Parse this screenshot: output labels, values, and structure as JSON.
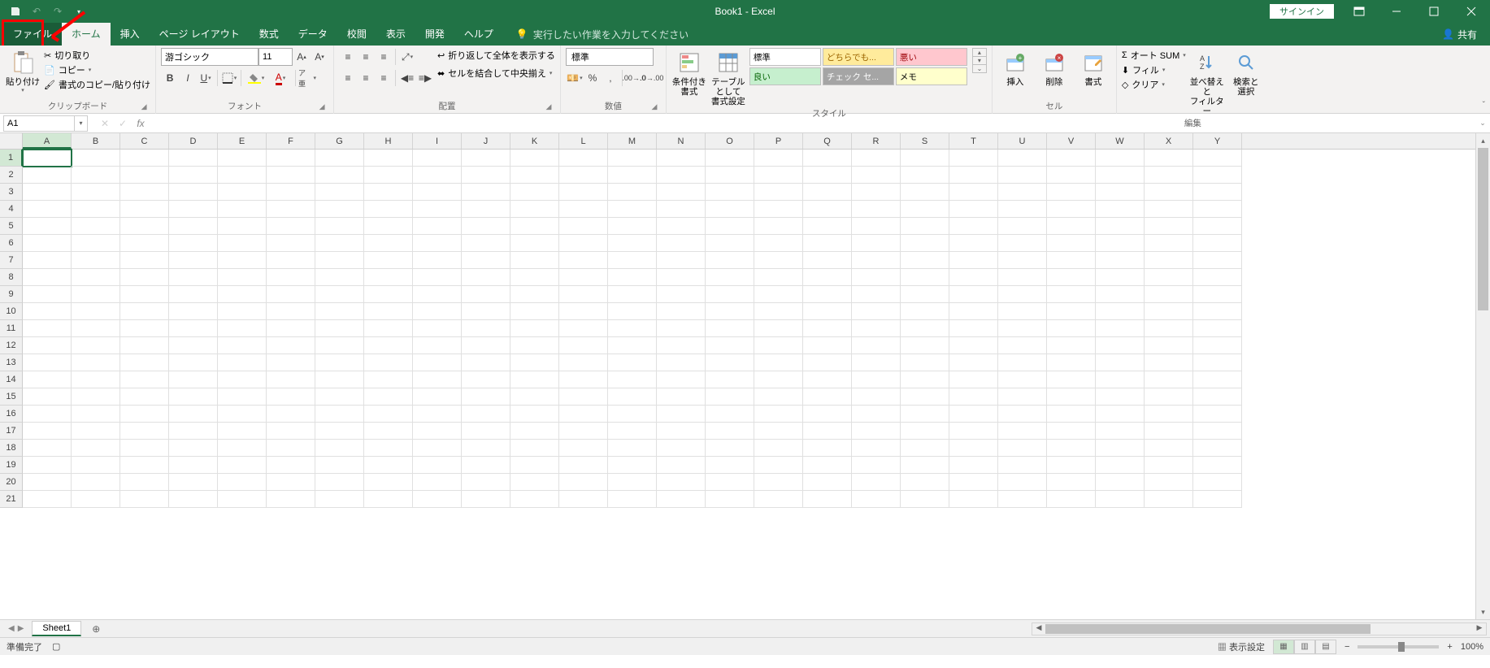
{
  "title": "Book1 - Excel",
  "signin": "サインイン",
  "tabs": {
    "file": "ファイル",
    "home": "ホーム",
    "insert": "挿入",
    "page_layout": "ページ レイアウト",
    "formulas": "数式",
    "data": "データ",
    "review": "校閲",
    "view": "表示",
    "developer": "開発",
    "help": "ヘルプ",
    "tell_me": "実行したい作業を入力してください",
    "share": "共有"
  },
  "ribbon": {
    "clipboard": {
      "paste": "貼り付け",
      "cut": "切り取り",
      "copy": "コピー",
      "format_painter": "書式のコピー/貼り付け",
      "label": "クリップボード"
    },
    "font": {
      "name": "游ゴシック",
      "size": "11",
      "label": "フォント"
    },
    "alignment": {
      "wrap": "折り返して全体を表示する",
      "merge": "セルを結合して中央揃え",
      "label": "配置"
    },
    "number": {
      "format": "標準",
      "label": "数値"
    },
    "styles": {
      "cond_fmt": "条件付き\n書式",
      "table": "テーブルとして\n書式設定",
      "s1": "標準",
      "s2": "どちらでも...",
      "s3": "悪い",
      "s4": "良い",
      "s5": "チェック セ...",
      "s6": "メモ",
      "label": "スタイル"
    },
    "cells": {
      "insert": "挿入",
      "delete": "削除",
      "format": "書式",
      "label": "セル"
    },
    "editing": {
      "autosum": "オート SUM",
      "fill": "フィル",
      "clear": "クリア",
      "sort": "並べ替えと\nフィルター",
      "find": "検索と\n選択",
      "label": "編集"
    }
  },
  "name_box": "A1",
  "columns": [
    "A",
    "B",
    "C",
    "D",
    "E",
    "F",
    "G",
    "H",
    "I",
    "J",
    "K",
    "L",
    "M",
    "N",
    "O",
    "P",
    "Q",
    "R",
    "S",
    "T",
    "U",
    "V",
    "W",
    "X",
    "Y"
  ],
  "rows": [
    1,
    2,
    3,
    4,
    5,
    6,
    7,
    8,
    9,
    10,
    11,
    12,
    13,
    14,
    15,
    16,
    17,
    18,
    19,
    20,
    21
  ],
  "sheet_tab": "Sheet1",
  "status": {
    "ready": "準備完了",
    "display_settings": "表示設定",
    "zoom": "100%"
  }
}
